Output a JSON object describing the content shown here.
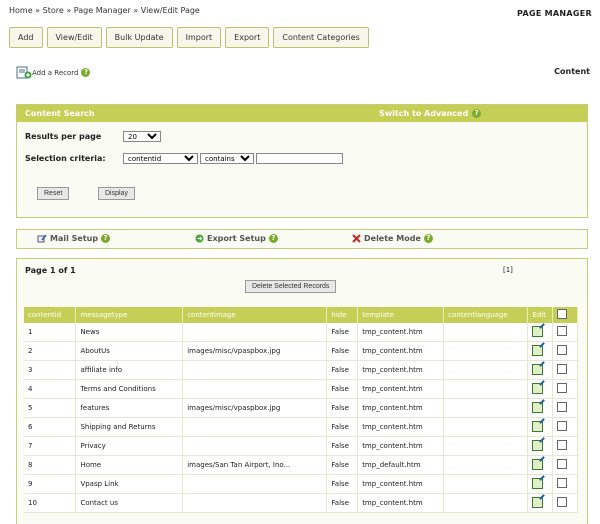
{
  "breadcrumb": {
    "home": "Home",
    "store": "Store",
    "page_manager": "Page Manager",
    "current": "View/Edit Page",
    "sep": "»"
  },
  "header": {
    "title": "PAGE MANAGER"
  },
  "tabs": [
    "Add",
    "View/Edit",
    "Bulk Update",
    "Import",
    "Export",
    "Content Categories"
  ],
  "add_record": {
    "label": "Add a Record",
    "help": "?"
  },
  "section_label": "Content",
  "search": {
    "title": "Content  Search",
    "switch_label": "Switch to Advanced",
    "results_label": "Results per page",
    "results_value": "20",
    "criteria_label": "Selection criteria:",
    "field_value": "contentid",
    "op_value": "contains",
    "text_value": "",
    "reset_label": "Reset",
    "display_label": "Display"
  },
  "setup": {
    "mail": "Mail Setup",
    "export": "Export Setup",
    "delete": "Delete Mode"
  },
  "results": {
    "page_label": "Page 1 of 1",
    "page_link": "[1]",
    "delete_selected": "Delete Selected Records",
    "columns": [
      "contentid",
      "messagetype",
      "contentimage",
      "hide",
      "template",
      "contentlanguage",
      "Edit"
    ],
    "rows": [
      {
        "id": "1",
        "type": "News",
        "image": "",
        "hide": "False",
        "template": "tmp_content.htm"
      },
      {
        "id": "2",
        "type": "AboutUs",
        "image": "images/misc/vpaspbox.jpg",
        "hide": "False",
        "template": "tmp_content.htm"
      },
      {
        "id": "3",
        "type": "affiliate info",
        "image": "",
        "hide": "False",
        "template": "tmp_content.htm"
      },
      {
        "id": "4",
        "type": "Terms and Conditions",
        "image": "",
        "hide": "False",
        "template": "tmp_content.htm"
      },
      {
        "id": "5",
        "type": "features",
        "image": "images/misc/vpaspbox.jpg",
        "hide": "False",
        "template": "tmp_content.htm"
      },
      {
        "id": "6",
        "type": "Shipping and Returns",
        "image": "",
        "hide": "False",
        "template": "tmp_content.htm"
      },
      {
        "id": "7",
        "type": "Privacy",
        "image": "",
        "hide": "False",
        "template": "tmp_content.htm"
      },
      {
        "id": "8",
        "type": "Home",
        "image": "images/San Tan Airport, Ino...",
        "hide": "False",
        "template": "tmp_default.htm"
      },
      {
        "id": "9",
        "type": "Vpasp Link",
        "image": "",
        "hide": "False",
        "template": "tmp_content.htm"
      },
      {
        "id": "10",
        "type": "Contact us",
        "image": "",
        "hide": "False",
        "template": "tmp_content.htm"
      }
    ]
  },
  "colors": {
    "accent": "#c6cf55",
    "panel_border": "#c5cd7a",
    "help_green": "#7aab2e",
    "delete_red": "#cc2222"
  }
}
